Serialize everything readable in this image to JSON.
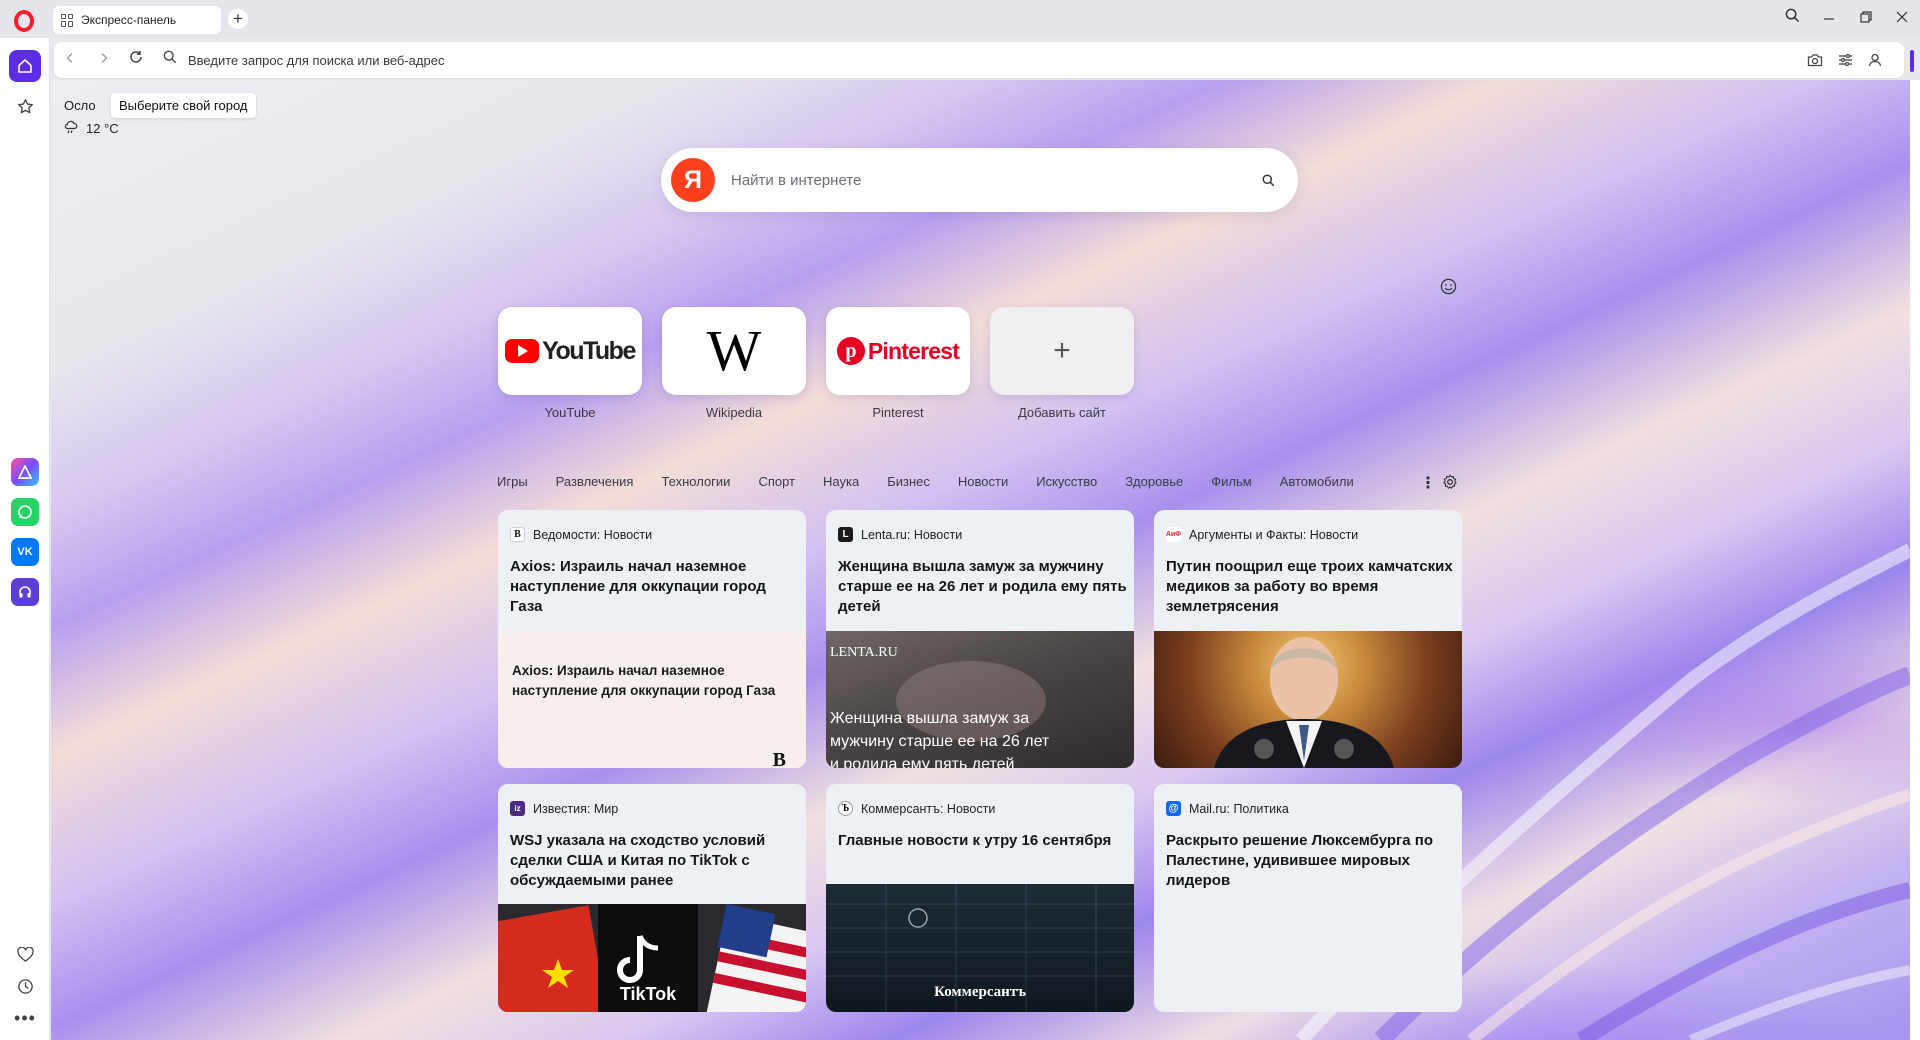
{
  "tab": {
    "title": "Экспресс-панель"
  },
  "addressbar": {
    "placeholder": "Введите запрос для поиска или веб-адрес"
  },
  "weather": {
    "city": "Осло",
    "tooltip": "Выберите свой город",
    "temperature": "12 °C"
  },
  "search": {
    "placeholder": "Найти в интернете",
    "logo_letter": "Я"
  },
  "speed_dial": [
    {
      "label": "YouTube",
      "mark": "YouTube"
    },
    {
      "label": "Wikipedia",
      "mark": "W"
    },
    {
      "label": "Pinterest",
      "mark": "Pinterest"
    },
    {
      "label": "Добавить сайт",
      "mark": "+"
    }
  ],
  "categories": [
    "Игры",
    "Развлечения",
    "Технологии",
    "Спорт",
    "Наука",
    "Бизнес",
    "Новости",
    "Искусство",
    "Здоровье",
    "Фильм",
    "Автомобили"
  ],
  "news": [
    {
      "source": "Ведомости: Новости",
      "icon_letter": "B",
      "icon_color": "#1a1a1a",
      "title": "Axios: Израиль начал наземное наступление для оккупации город Газа",
      "image_text": "Axios: Израиль начал наземное наступление для оккупации город Газа",
      "image_mark": "B"
    },
    {
      "source": "Lenta.ru: Новости",
      "icon_letter": "L",
      "icon_color": "#1a1a1a",
      "title": "Женщина вышла замуж за мужчину старше ее на 26 лет и родила ему пять детей",
      "image_brand": "LENTA.RU",
      "image_text": "Женщина вышла замуж за мужчину старше ее на 26 лет и родила ему пять детей"
    },
    {
      "source": "Аргументы и Факты: Новости",
      "icon_letter": "АиФ",
      "icon_color": "#e8232a",
      "title": "Путин поощрил еще троих камчатских медиков за работу во время землетрясения"
    },
    {
      "source": "Известия: Мир",
      "icon_letter": "iz",
      "icon_color": "#4b2a86",
      "title": "WSJ указала на сходство условий сделки США и Китая по TikTok с обсуждаемыми ранее",
      "image_text": "TikTok"
    },
    {
      "source": "Коммерсантъ: Новости",
      "icon_letter": "Ъ",
      "icon_color": "#1a1a1a",
      "title": "Главные новости к утру 16 сентября",
      "image_text": "Коммерсантъ"
    },
    {
      "source": "Mail.ru: Политика",
      "icon_letter": "@",
      "icon_color": "#0f6bff",
      "title": "Раскрыто решение Люксембурга по Палестине, удивившее мировых лидеров"
    }
  ],
  "colors": {
    "accent": "#5c2ce6",
    "opera_red": "#ff1b2d",
    "yandex_red": "#fc3f1d"
  }
}
